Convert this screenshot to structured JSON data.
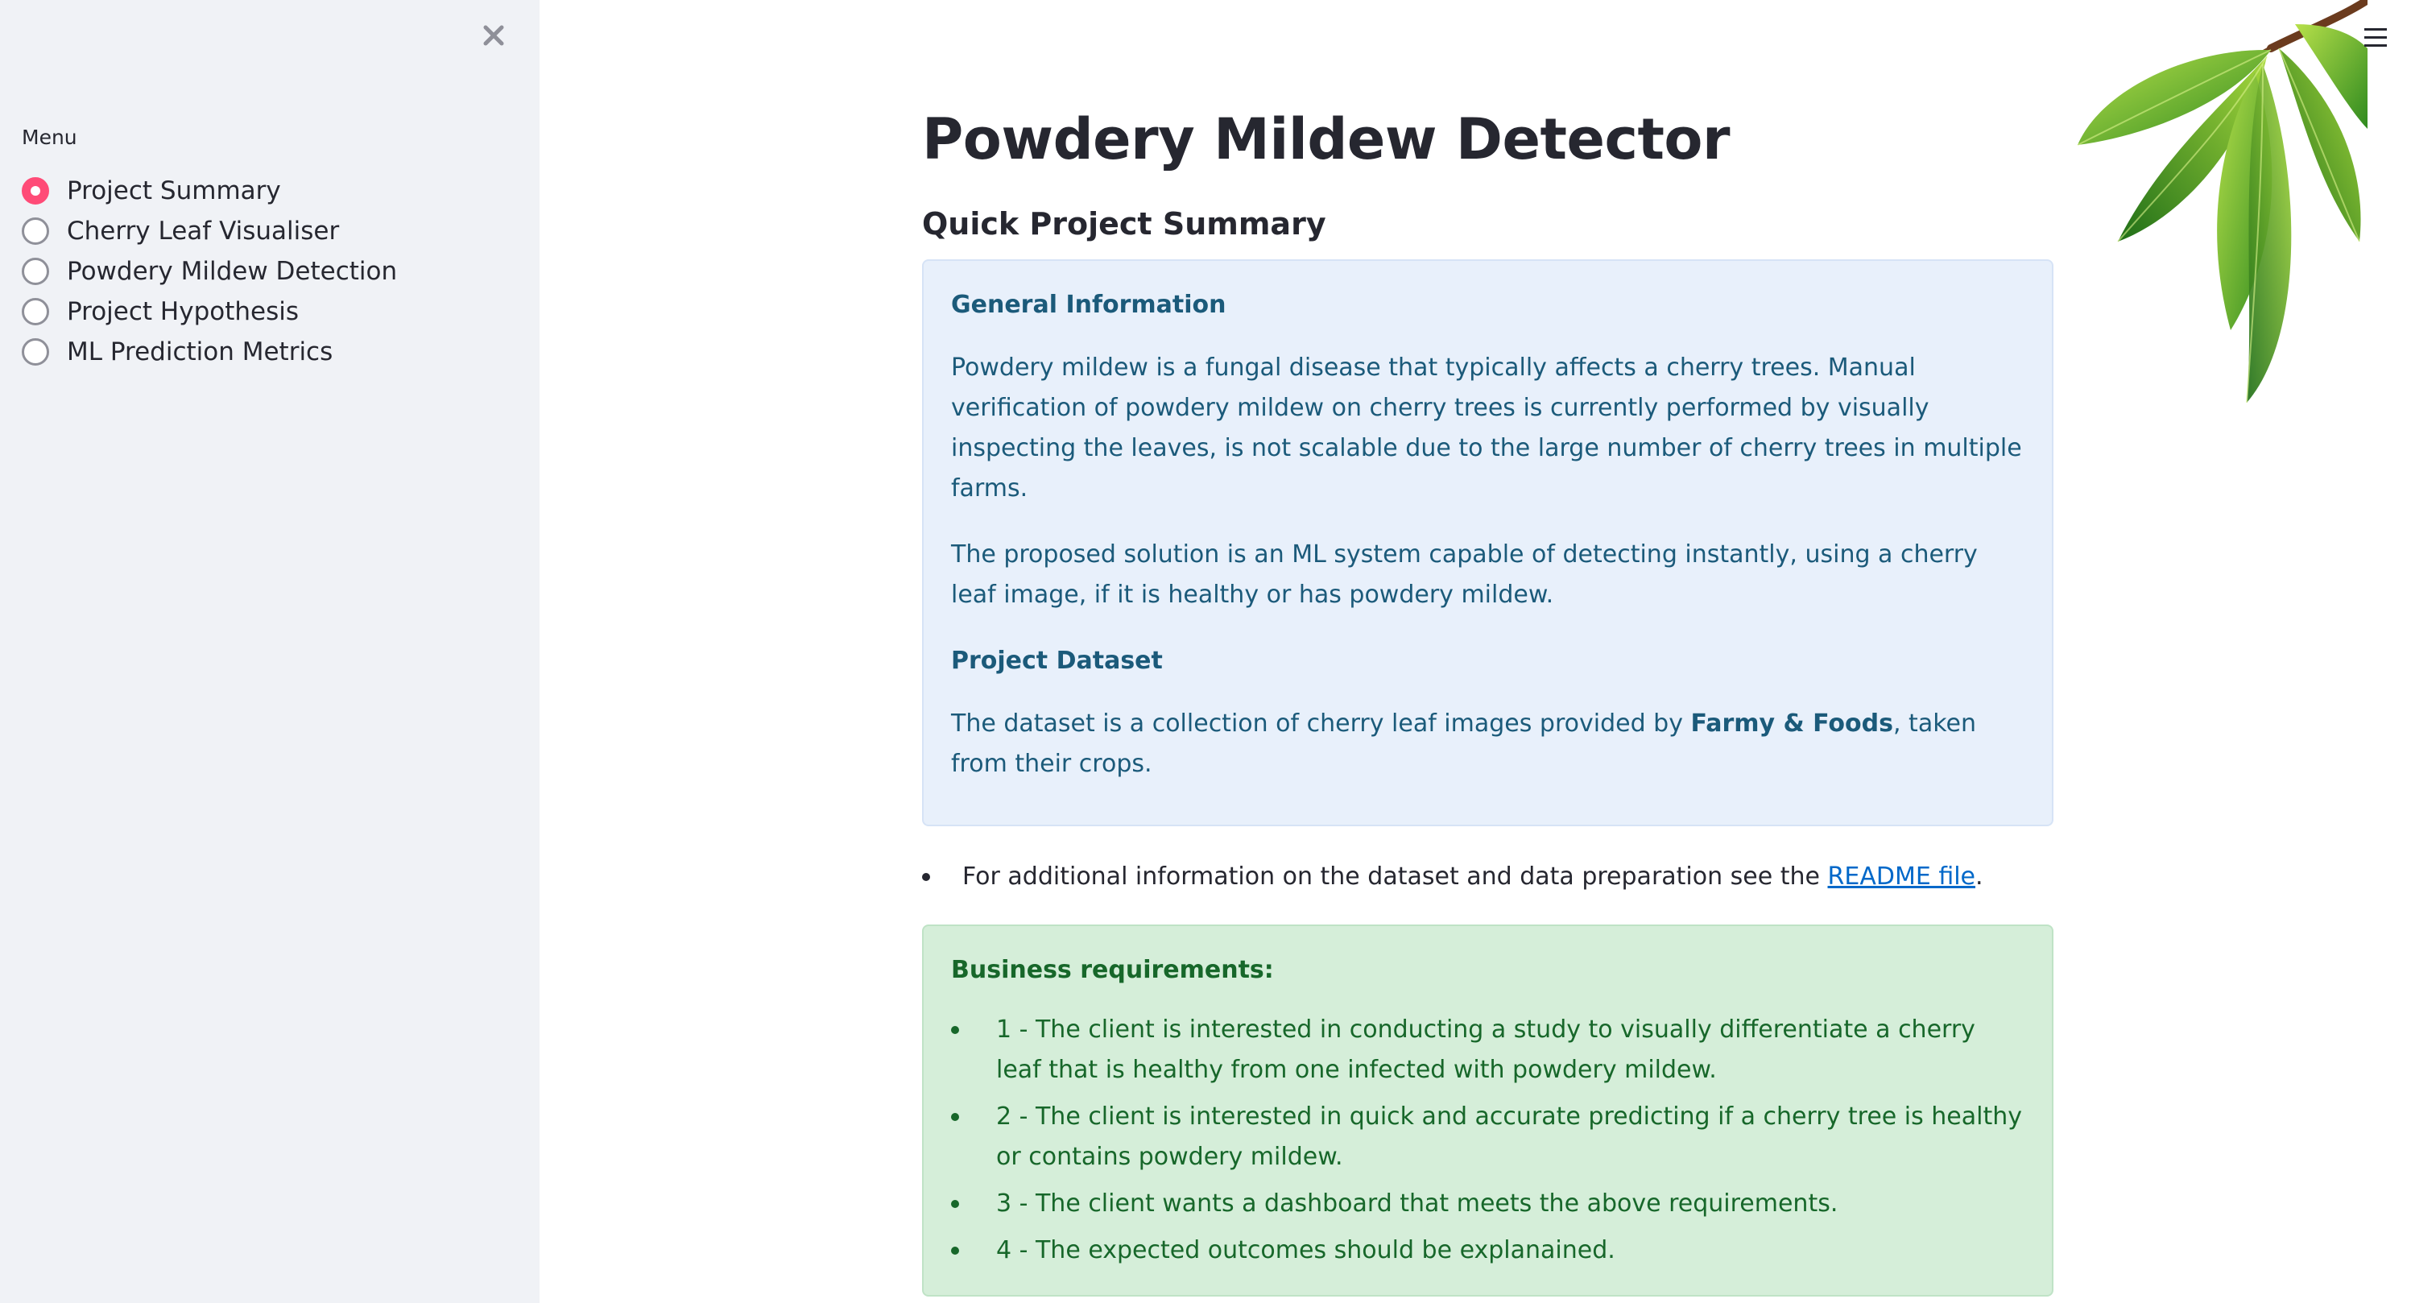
{
  "sidebar": {
    "menu_label": "Menu",
    "items": [
      {
        "label": "Project Summary",
        "selected": true
      },
      {
        "label": "Cherry Leaf Visualiser",
        "selected": false
      },
      {
        "label": "Powdery Mildew Detection",
        "selected": false
      },
      {
        "label": "Project Hypothesis",
        "selected": false
      },
      {
        "label": "ML Prediction Metrics",
        "selected": false
      }
    ],
    "close_icon": "close-icon"
  },
  "header": {
    "menu_icon": "hamburger-menu-icon"
  },
  "main": {
    "title": "Powdery Mildew Detector",
    "subheader": "Quick Project Summary",
    "info_box": {
      "heading1": "General Information",
      "para1": "Powdery mildew is a fungal disease that typically affects a cherry trees. Manual verification of powdery mildew on cherry trees is currently performed by visually inspecting the leaves, is not scalable due to the large number of cherry trees in multiple farms.",
      "para2": "The proposed solution is an ML system capable of detecting instantly, using a cherry leaf image, if it is healthy or has powdery mildew.",
      "heading2": "Project Dataset",
      "para3_prefix": "The dataset is a collection of cherry leaf images provided by ",
      "para3_bold": "Farmy & Foods",
      "para3_suffix": ", taken from their crops."
    },
    "readme_line": {
      "prefix": "For additional information on the dataset and data preparation see the ",
      "link": "README file",
      "suffix": "."
    },
    "requirements": {
      "heading": "Business requirements:",
      "items": [
        "1 - The client is interested in conducting a study to visually differentiate a cherry leaf that is healthy from one infected with powdery mildew.",
        "2 - The client is interested in quick and accurate predicting if a cherry tree is healthy or contains powdery mildew.",
        "3 - The client wants a dashboard that meets the above requirements.",
        "4 - The expected outcomes should be explanained."
      ]
    }
  },
  "colors": {
    "sidebar_bg": "#f0f2f6",
    "radio_selected": "#ff4b77",
    "info_bg": "#e8f0fb",
    "info_text": "#1b5a7a",
    "success_bg": "#d5eed9",
    "success_text": "#17672a",
    "link": "#0068c9"
  }
}
